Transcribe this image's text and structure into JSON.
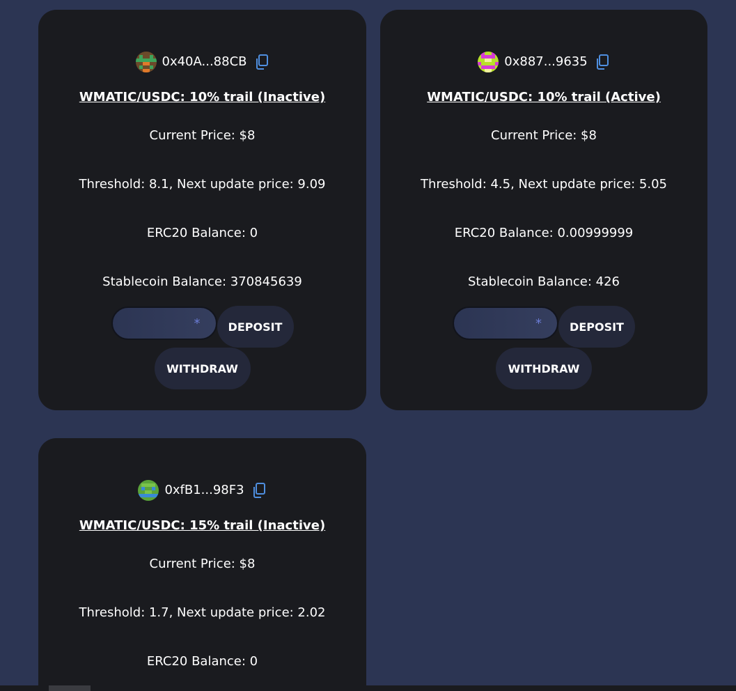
{
  "cards": [
    {
      "address": "0x40A...88CB",
      "title": "WMATIC/USDC: 10% trail (Inactive)",
      "current_price": "Current Price: $8",
      "threshold": "Threshold: 8.1, Next update price: 9.09",
      "erc20_balance": "ERC20 Balance: 0",
      "stablecoin_balance": "Stablecoin Balance: 370845639",
      "input_placeholder": "*",
      "deposit_label": "DEPOSIT",
      "withdraw_label": "WITHDRAW",
      "avatar_colors": [
        "#6b4a2a",
        "#3fa35a",
        "#e07a2a"
      ]
    },
    {
      "address": "0x887...9635",
      "title": "WMATIC/USDC: 10% trail (Active)",
      "current_price": "Current Price: $8",
      "threshold": "Threshold: 4.5, Next update price: 5.05",
      "erc20_balance": "ERC20 Balance: 0.00999999",
      "stablecoin_balance": "Stablecoin Balance: 426",
      "input_placeholder": "*",
      "deposit_label": "DEPOSIT",
      "withdraw_label": "WITHDRAW",
      "avatar_colors": [
        "#d63ad6",
        "#b8e02a",
        "#f2f2a0"
      ]
    },
    {
      "address": "0xfB1...98F3",
      "title": "WMATIC/USDC: 15% trail (Inactive)",
      "current_price": "Current Price: $8",
      "threshold": "Threshold: 1.7, Next update price: 2.02",
      "erc20_balance": "ERC20 Balance: 0",
      "avatar_colors": [
        "#5aa33a",
        "#3a8ad6",
        "#7ac24a"
      ]
    }
  ],
  "icons": {
    "copy": "copy-icon",
    "avatar": "identicon-avatar"
  },
  "colors": {
    "background": "#2c3553",
    "card": "#1a1b1f",
    "button": "#24283a",
    "accent": "#4f8fe0"
  }
}
